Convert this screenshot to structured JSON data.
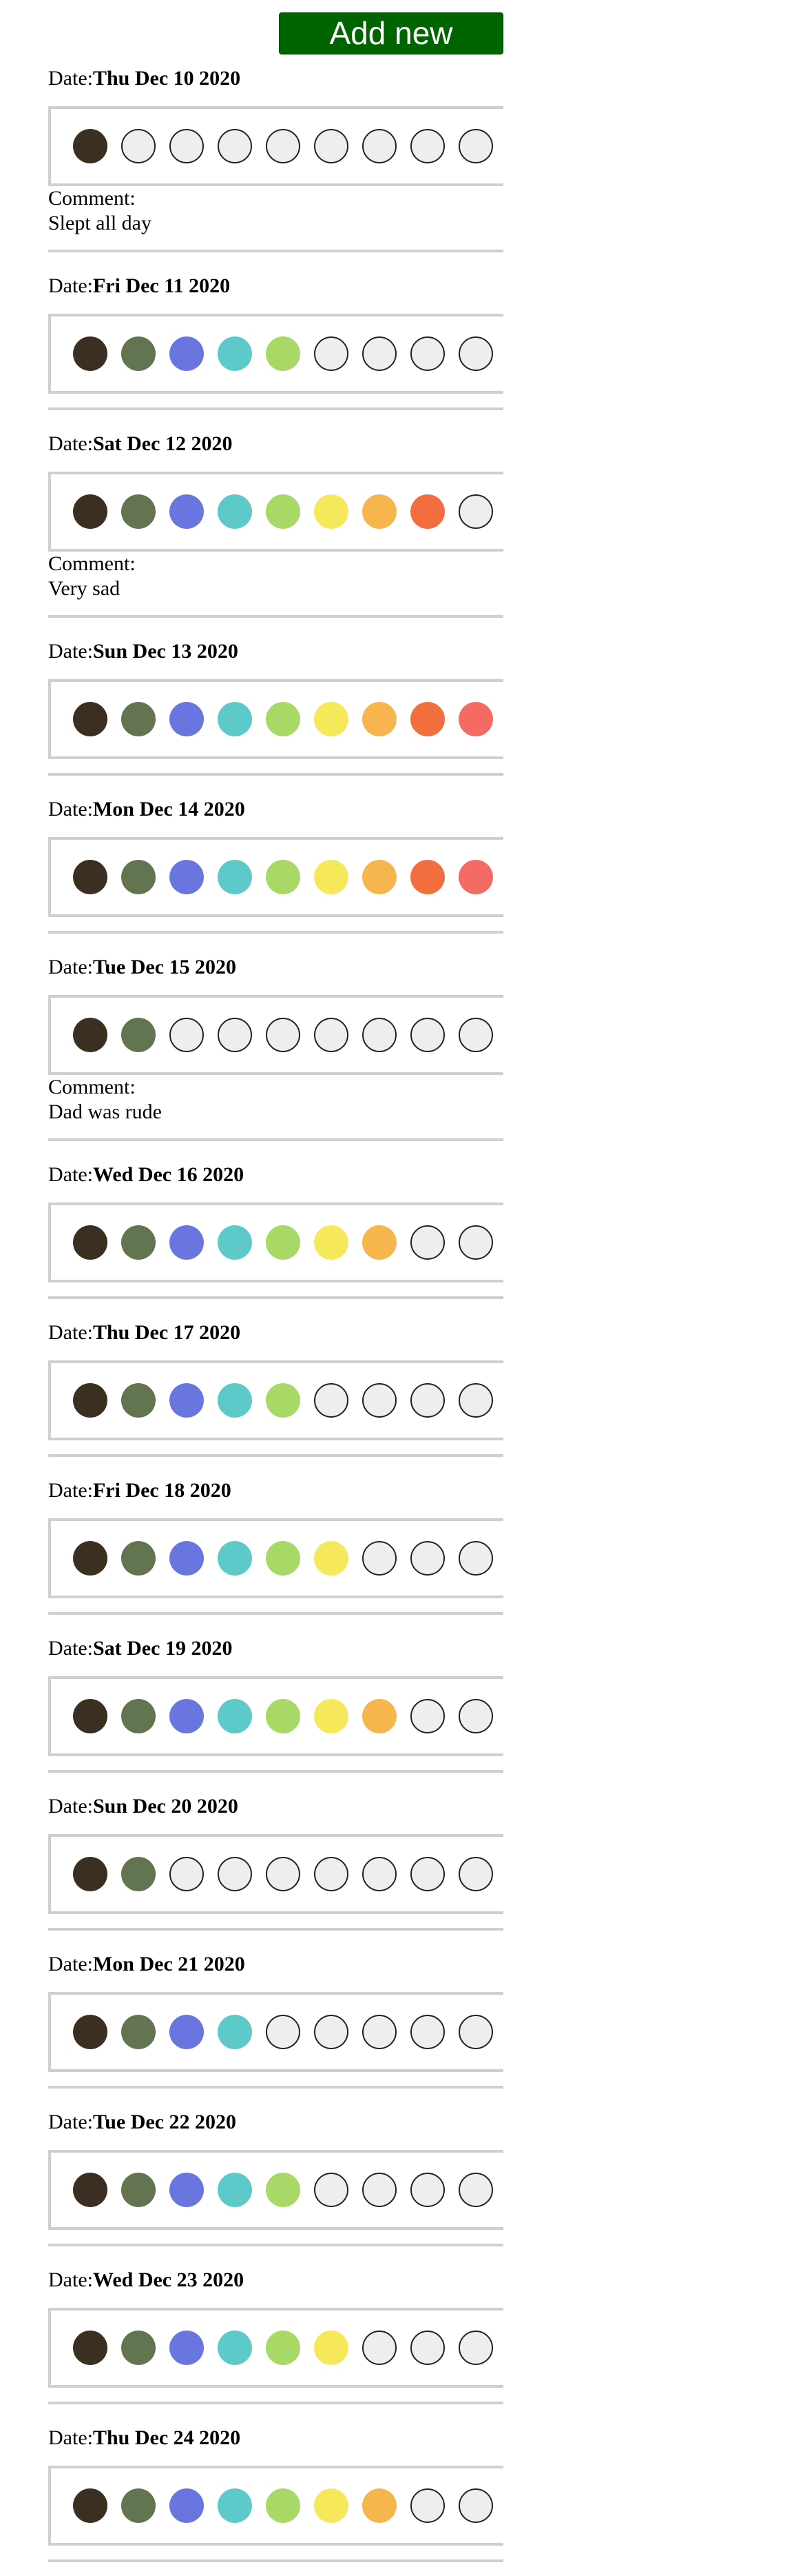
{
  "add_button": {
    "label": "Add new"
  },
  "labels": {
    "date_prefix": "Date:",
    "comment_prefix": "Comment:"
  },
  "mood_colors": [
    "#3b2f22",
    "#627550",
    "#6a76e0",
    "#5ec9c9",
    "#a8d865",
    "#f5e85a",
    "#f7b54e",
    "#f26e3f",
    "#f36b63"
  ],
  "entries": [
    {
      "date": "Thu Dec 10 2020",
      "level": 1,
      "comment": "Slept all day"
    },
    {
      "date": "Fri Dec 11 2020",
      "level": 5,
      "comment": ""
    },
    {
      "date": "Sat Dec 12 2020",
      "level": 8,
      "comment": "Very sad"
    },
    {
      "date": "Sun Dec 13 2020",
      "level": 9,
      "comment": ""
    },
    {
      "date": "Mon Dec 14 2020",
      "level": 9,
      "comment": ""
    },
    {
      "date": "Tue Dec 15 2020",
      "level": 2,
      "comment": "Dad was rude"
    },
    {
      "date": "Wed Dec 16 2020",
      "level": 7,
      "comment": ""
    },
    {
      "date": "Thu Dec 17 2020",
      "level": 5,
      "comment": ""
    },
    {
      "date": "Fri Dec 18 2020",
      "level": 6,
      "comment": ""
    },
    {
      "date": "Sat Dec 19 2020",
      "level": 7,
      "comment": ""
    },
    {
      "date": "Sun Dec 20 2020",
      "level": 2,
      "comment": ""
    },
    {
      "date": "Mon Dec 21 2020",
      "level": 4,
      "comment": ""
    },
    {
      "date": "Tue Dec 22 2020",
      "level": 5,
      "comment": ""
    },
    {
      "date": "Wed Dec 23 2020",
      "level": 6,
      "comment": ""
    },
    {
      "date": "Thu Dec 24 2020",
      "level": 7,
      "comment": ""
    }
  ]
}
